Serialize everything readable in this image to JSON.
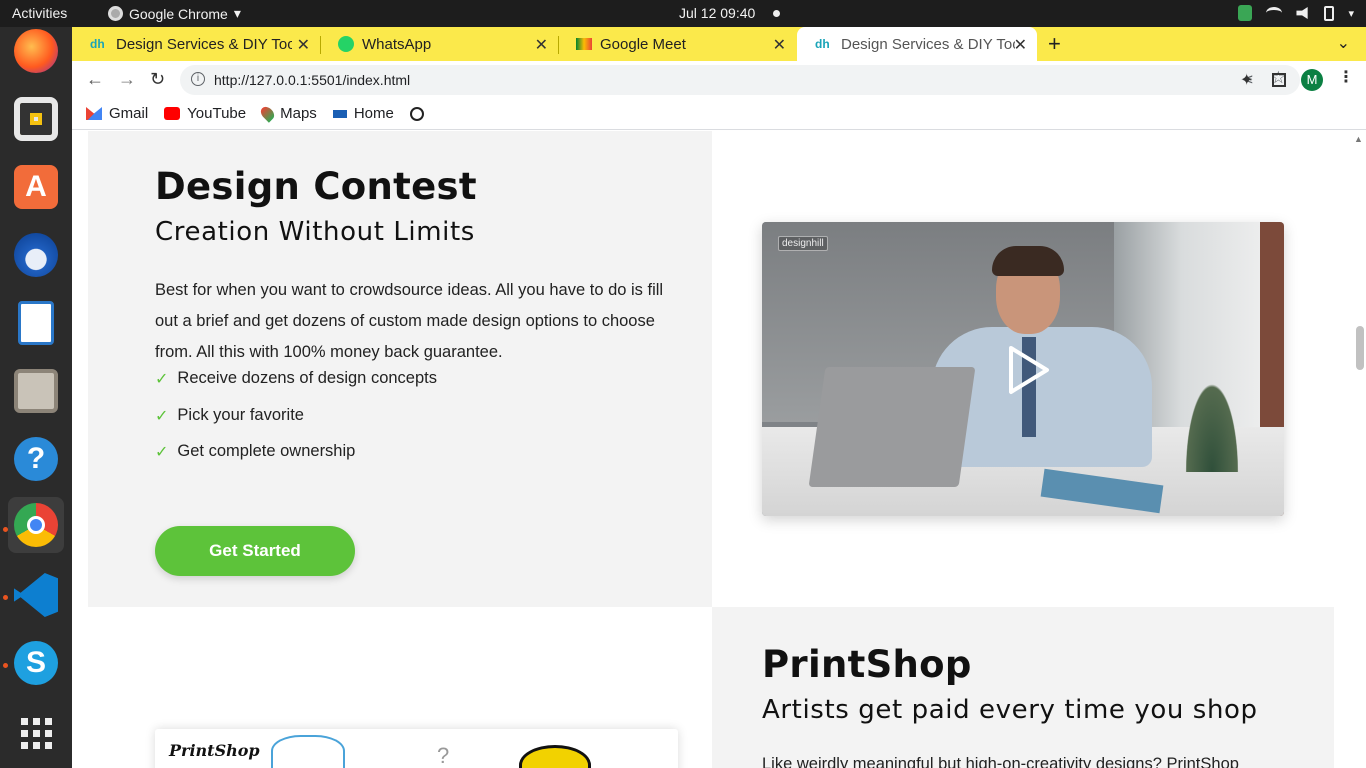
{
  "system": {
    "activities": "Activities",
    "app_name": "Google Chrome",
    "datetime": "Jul 12  09:40"
  },
  "tabs": [
    {
      "label": "Design Services & DIY Too",
      "favicon": "dh"
    },
    {
      "label": "WhatsApp"
    },
    {
      "label": "Google Meet"
    },
    {
      "label": "Design Services & DIY Too",
      "favicon": "dh",
      "active": true
    }
  ],
  "toolbar": {
    "url": "http://127.0.0.1:5501/index.html",
    "avatar_letter": "M"
  },
  "bookmarks": [
    {
      "label": "Gmail",
      "icon": "gmail-icon"
    },
    {
      "label": "YouTube",
      "icon": "youtube-icon"
    },
    {
      "label": "Maps",
      "icon": "maps-icon"
    },
    {
      "label": "Home",
      "icon": "home-icon"
    }
  ],
  "contest": {
    "title": "Design Contest",
    "subtitle": "Creation Without Limits",
    "description": "Best for when you want to crowdsource ideas. All you have to do is fill out a brief and get dozens of custom made design options to choose from. All this with 100% money back guarantee.",
    "bullets": [
      "Receive dozens of design concepts",
      "Pick your favorite",
      "Get complete ownership"
    ],
    "check": "✓",
    "cta": "Get Started",
    "video_logo": "designhill"
  },
  "printshop": {
    "title": "PrintShop",
    "subtitle": "Artists get paid every time you shop",
    "description": "Like weirdly meaningful but high-on-creativity designs? PrintShop",
    "card_logo": "PrintShop"
  },
  "colors": {
    "accent_green": "#5dc33a",
    "tab_strip": "#fbe94b",
    "panel_grey": "#f3f3f3"
  }
}
